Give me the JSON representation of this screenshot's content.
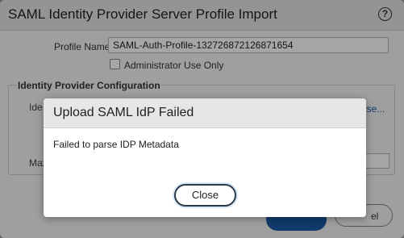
{
  "dialog": {
    "title": "SAML Identity Provider Server Profile Import",
    "help_icon_glyph": "?",
    "profile_name_label": "Profile Name",
    "profile_name_value": "SAML-Auth-Profile-132726872126871654",
    "admin_use_only_label": "Administrator Use Only",
    "admin_use_only_checked": false,
    "idp_config_legend": "Identity Provider Configuration",
    "partial_label_ide": "Ide",
    "partial_browse_link": "wse...",
    "partial_label_max": "Max",
    "partial_cancel_label": "el"
  },
  "modal": {
    "title": "Upload SAML IdP Failed",
    "message": "Failed to parse IDP Metadata",
    "close_label": "Close"
  },
  "colors": {
    "accent": "#1d5aa7",
    "overlay": "rgba(0,0,0,0.35)"
  }
}
